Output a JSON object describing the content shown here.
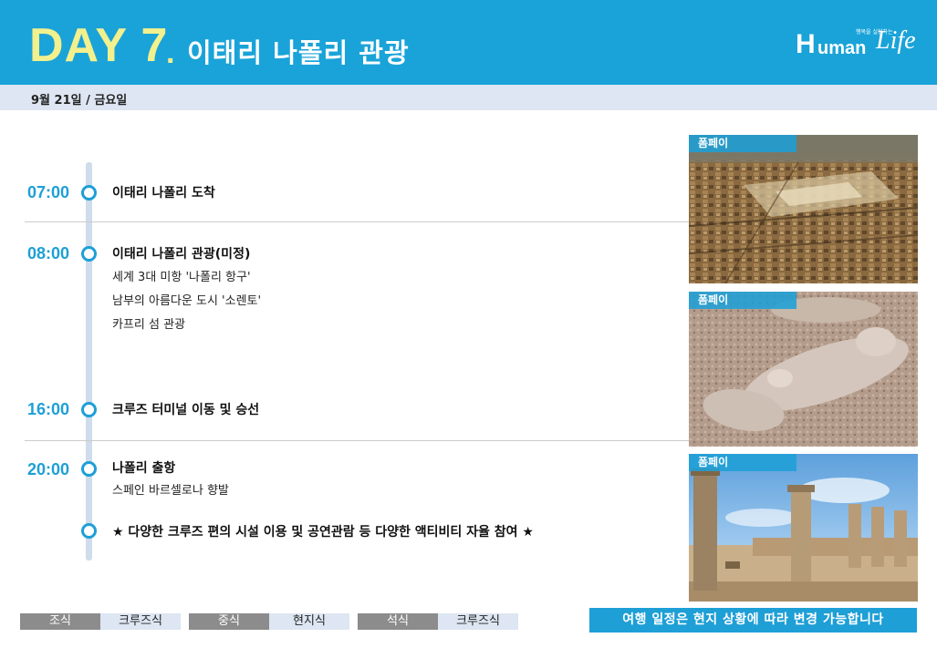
{
  "header": {
    "day": "DAY 7",
    "dot": ".",
    "title": "이태리 나폴리 관광",
    "logo": {
      "tagline": "행복을 실현하는",
      "h": "H",
      "uman": "uman",
      "life": "Life"
    }
  },
  "date": "9월 21일 / 금요일",
  "timeline": [
    {
      "time": "07:00",
      "title": "이태리 나폴리 도착",
      "details": []
    },
    {
      "time": "08:00",
      "title": "이태리 나폴리 관광(미정)",
      "details": [
        "세계 3대 미항 '나폴리 항구'",
        "남부의 아름다운 도시 '소렌토'",
        "카프리 섬 관광"
      ]
    },
    {
      "time": "16:00",
      "title": "크루즈 터미널 이동 및 승선",
      "details": []
    },
    {
      "time": "20:00",
      "title": "나폴리 출항",
      "details": [
        "스페인 바르셀로나 향발"
      ]
    },
    {
      "time": "",
      "title": "★ 다양한 크루즈 편의 시설 이용 및 공연관람 등 다양한 액티비티 자율 참여 ★",
      "details": []
    }
  ],
  "photos": [
    {
      "label": "폼페이"
    },
    {
      "label": "폼페이"
    },
    {
      "label": "폼페이"
    }
  ],
  "meals": [
    {
      "label": "조식",
      "value": "크루즈식"
    },
    {
      "label": "중식",
      "value": "현지식"
    },
    {
      "label": "석식",
      "value": "크루즈식"
    }
  ],
  "notice": "여행 일정은 현지 상황에 따라 변경 가능합니다",
  "colors": {
    "accent": "#1aa3d8",
    "day_yellow": "#f3f08e",
    "band": "#dde6f2",
    "meal_gray": "#8c8c8c"
  }
}
